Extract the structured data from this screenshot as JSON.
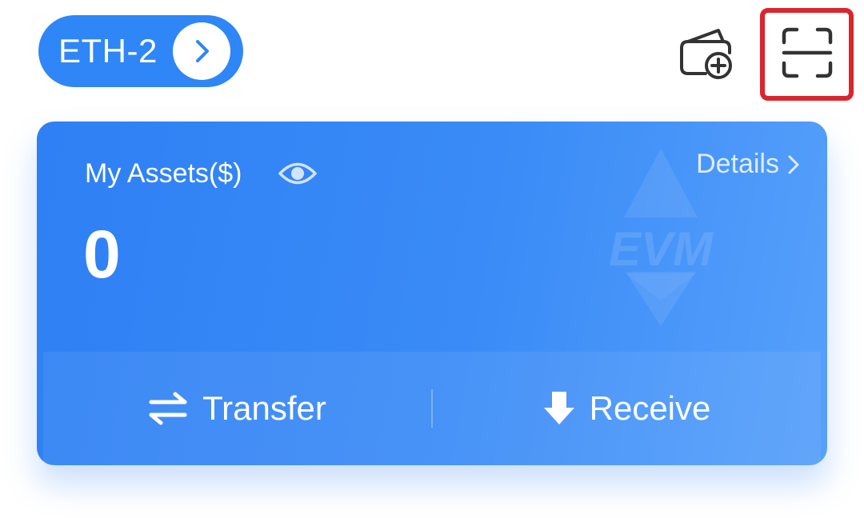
{
  "header": {
    "network_label": "ETH-2",
    "network_chevron_icon": "chevron-right-icon",
    "wallet_add_icon": "wallet-add-icon",
    "scan_icon": "scan-icon",
    "highlight_color": "#d9262e"
  },
  "assets_card": {
    "title": "My Assets($)",
    "visibility_icon": "eye-icon",
    "details_label": "Details",
    "details_icon": "chevron-right-icon",
    "balance": "0",
    "watermark_text": "EVM",
    "background_color": "#3a8bf7"
  },
  "actions": {
    "transfer_label": "Transfer",
    "transfer_icon": "swap-arrows-icon",
    "receive_label": "Receive",
    "receive_icon": "arrow-down-icon"
  },
  "accent_color": "#2f86f6"
}
